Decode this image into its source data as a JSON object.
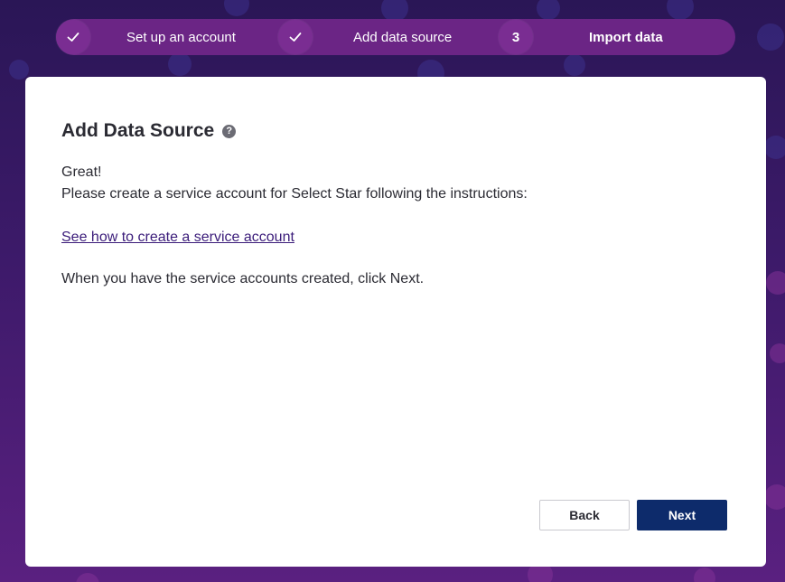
{
  "stepper": {
    "steps": [
      {
        "marker": "✓",
        "label": "Set up an account",
        "state": "done"
      },
      {
        "marker": "✓",
        "label": "Add data source",
        "state": "done"
      },
      {
        "marker": "3",
        "label": "Import data",
        "state": "active"
      }
    ]
  },
  "card": {
    "title": "Add Data Source",
    "help_icon": "question-circle-icon",
    "help_glyph": "?",
    "line1": "Great!",
    "line2": "Please create a service account for Select Star following the instructions:",
    "link_text": "See how to create a service account",
    "line3": "When you have the service accounts created, click Next."
  },
  "buttons": {
    "back_label": "Back",
    "next_label": "Next"
  },
  "colors": {
    "stepper_bg": "#6b2585",
    "primary_button": "#0d2b6b",
    "link": "#3b1c7a"
  }
}
